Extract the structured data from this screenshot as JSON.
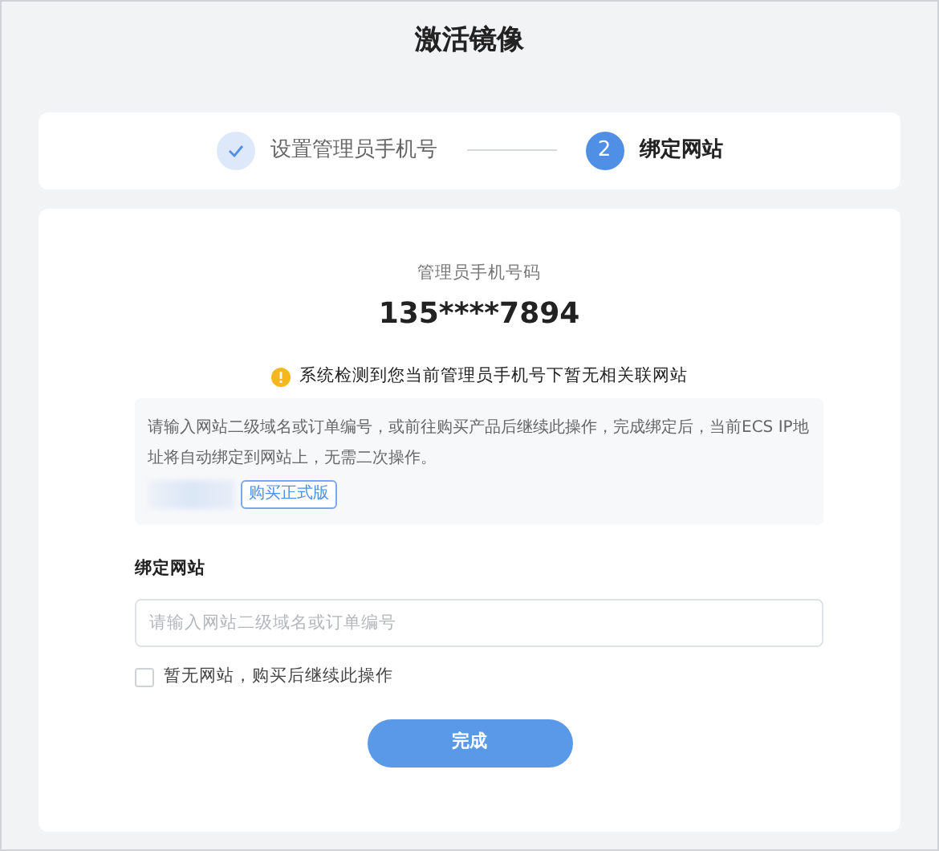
{
  "title": "激活镜像",
  "steps": [
    {
      "label": "设置管理员手机号",
      "kind": "done"
    },
    {
      "label": "绑定网站",
      "number": "2",
      "kind": "current"
    }
  ],
  "phone": {
    "label": "管理员手机号码",
    "value": "135****7894"
  },
  "warning": "系统检测到您当前管理员手机号下暂无相关联网站",
  "info": {
    "text": "请输入网站二级域名或订单编号，或前往购买产品后继续此操作，完成绑定后，当前ECS IP地址将自动绑定到网站上，无需二次操作。",
    "button": "购买正式版"
  },
  "field": {
    "label": "绑定网站",
    "placeholder": "请输入网站二级域名或订单编号"
  },
  "checkbox": {
    "label": "暂无网站，购买后继续此操作",
    "checked": false
  },
  "submit": "完成"
}
